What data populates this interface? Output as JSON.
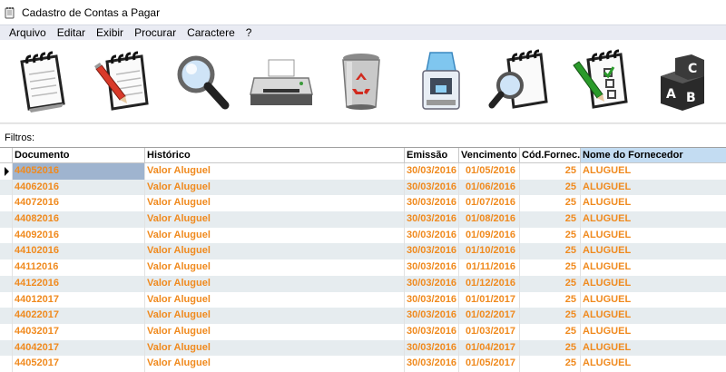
{
  "window": {
    "title": "Cadastro de Contas a Pagar"
  },
  "menu": [
    {
      "label": "Arquivo"
    },
    {
      "label": "Editar"
    },
    {
      "label": "Exibir"
    },
    {
      "label": "Procurar"
    },
    {
      "label": "Caractere"
    },
    {
      "label": "?"
    }
  ],
  "toolbar": [
    {
      "icon": "notepad-icon"
    },
    {
      "icon": "notepad-edit-icon"
    },
    {
      "icon": "magnifier-icon"
    },
    {
      "icon": "printer-icon"
    },
    {
      "icon": "recycle-bin-icon"
    },
    {
      "icon": "water-cooler-icon"
    },
    {
      "icon": "notepad-search-icon"
    },
    {
      "icon": "checklist-icon"
    },
    {
      "icon": "abc-blocks-icon"
    }
  ],
  "filter": {
    "label": "Filtros:"
  },
  "grid": {
    "columns": [
      "Documento",
      "Histórico",
      "Emissão",
      "Vencimento",
      "Cód.Fornec.",
      "Nome do Fornecedor"
    ],
    "rows": [
      [
        "44052016",
        "Valor Aluguel",
        "30/03/2016",
        "01/05/2016",
        "25",
        "ALUGUEL"
      ],
      [
        "44062016",
        "Valor Aluguel",
        "30/03/2016",
        "01/06/2016",
        "25",
        "ALUGUEL"
      ],
      [
        "44072016",
        "Valor Aluguel",
        "30/03/2016",
        "01/07/2016",
        "25",
        "ALUGUEL"
      ],
      [
        "44082016",
        "Valor Aluguel",
        "30/03/2016",
        "01/08/2016",
        "25",
        "ALUGUEL"
      ],
      [
        "44092016",
        "Valor Aluguel",
        "30/03/2016",
        "01/09/2016",
        "25",
        "ALUGUEL"
      ],
      [
        "44102016",
        "Valor Aluguel",
        "30/03/2016",
        "01/10/2016",
        "25",
        "ALUGUEL"
      ],
      [
        "44112016",
        "Valor Aluguel",
        "30/03/2016",
        "01/11/2016",
        "25",
        "ALUGUEL"
      ],
      [
        "44122016",
        "Valor Aluguel",
        "30/03/2016",
        "01/12/2016",
        "25",
        "ALUGUEL"
      ],
      [
        "44012017",
        "Valor Aluguel",
        "30/03/2016",
        "01/01/2017",
        "25",
        "ALUGUEL"
      ],
      [
        "44022017",
        "Valor Aluguel",
        "30/03/2016",
        "01/02/2017",
        "25",
        "ALUGUEL"
      ],
      [
        "44032017",
        "Valor Aluguel",
        "30/03/2016",
        "01/03/2017",
        "25",
        "ALUGUEL"
      ],
      [
        "44042017",
        "Valor Aluguel",
        "30/03/2016",
        "01/04/2017",
        "25",
        "ALUGUEL"
      ],
      [
        "44052017",
        "Valor Aluguel",
        "30/03/2016",
        "01/05/2017",
        "25",
        "ALUGUEL"
      ]
    ]
  },
  "colors": {
    "row_text": "#f08a1e",
    "sorted_header": "#c3dcf2",
    "selected_cell": "#9fb4cf",
    "alt_row": "#e6ecef",
    "menu_bg": "#e9ebf3"
  }
}
